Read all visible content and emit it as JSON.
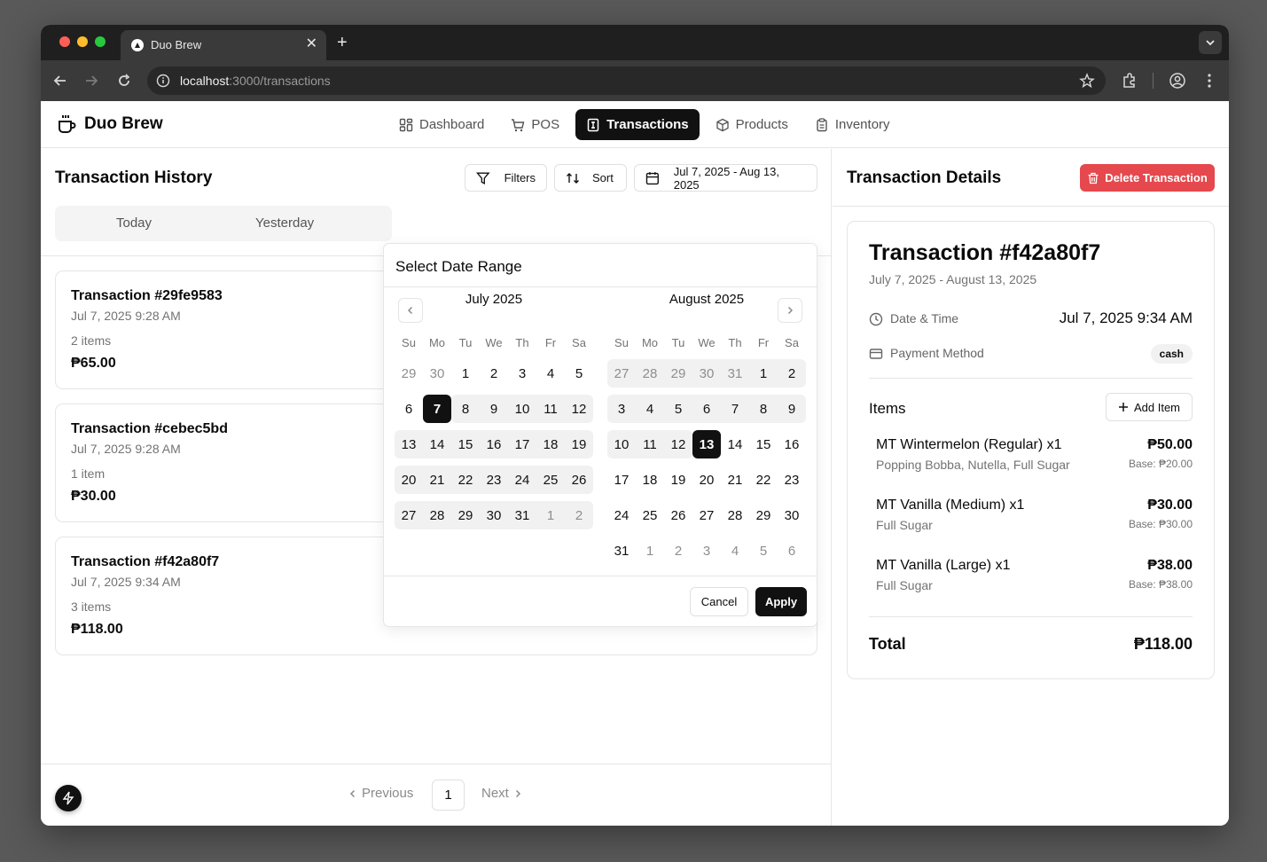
{
  "browser": {
    "tab_title": "Duo Brew",
    "url_host": "localhost",
    "url_path": ":3000/transactions"
  },
  "app": {
    "brand": "Duo Brew",
    "nav": [
      {
        "label": "Dashboard",
        "icon": "dashboard-icon"
      },
      {
        "label": "POS",
        "icon": "cart-icon"
      },
      {
        "label": "Transactions",
        "icon": "receipt-icon",
        "active": true
      },
      {
        "label": "Products",
        "icon": "package-icon"
      },
      {
        "label": "Inventory",
        "icon": "clipboard-icon"
      }
    ]
  },
  "history": {
    "title": "Transaction History",
    "filters_label": "Filters",
    "sort_label": "Sort",
    "date_range_label": "Jul 7, 2025 - Aug 13, 2025",
    "quick_tabs": [
      "Today",
      "Yesterday"
    ],
    "transactions": [
      {
        "title": "Transaction #29fe9583",
        "date": "Jul 7, 2025 9:28 AM",
        "items": "2 items",
        "total": "₱65.00"
      },
      {
        "title": "Transaction #cebec5bd",
        "date": "Jul 7, 2025 9:28 AM",
        "items": "1 item",
        "total": "₱30.00"
      },
      {
        "title": "Transaction #f42a80f7",
        "date": "Jul 7, 2025 9:34 AM",
        "items": "3 items",
        "total": "₱118.00"
      }
    ],
    "pagination": {
      "previous": "Previous",
      "page": "1",
      "next": "Next"
    }
  },
  "date_picker": {
    "title": "Select Date Range",
    "weekdays": [
      "Su",
      "Mo",
      "Tu",
      "We",
      "Th",
      "Fr",
      "Sa"
    ],
    "months": [
      {
        "title": "July 2025",
        "weeks": [
          [
            "29",
            "30",
            "1",
            "2",
            "3",
            "4",
            "5"
          ],
          [
            "6",
            "7",
            "8",
            "9",
            "10",
            "11",
            "12"
          ],
          [
            "13",
            "14",
            "15",
            "16",
            "17",
            "18",
            "19"
          ],
          [
            "20",
            "21",
            "22",
            "23",
            "24",
            "25",
            "26"
          ],
          [
            "27",
            "28",
            "29",
            "30",
            "31",
            "1",
            "2"
          ]
        ]
      },
      {
        "title": "August 2025",
        "weeks": [
          [
            "27",
            "28",
            "29",
            "30",
            "31",
            "1",
            "2"
          ],
          [
            "3",
            "4",
            "5",
            "6",
            "7",
            "8",
            "9"
          ],
          [
            "10",
            "11",
            "12",
            "13",
            "14",
            "15",
            "16"
          ],
          [
            "17",
            "18",
            "19",
            "20",
            "21",
            "22",
            "23"
          ],
          [
            "24",
            "25",
            "26",
            "27",
            "28",
            "29",
            "30"
          ],
          [
            "31",
            "1",
            "2",
            "3",
            "4",
            "5",
            "6"
          ]
        ]
      }
    ],
    "cancel_label": "Cancel",
    "apply_label": "Apply"
  },
  "details": {
    "title": "Transaction Details",
    "delete_label": "Delete Transaction",
    "transaction_title": "Transaction #f42a80f7",
    "range_subtitle": "July 7, 2025 - August 13, 2025",
    "date_time_label": "Date & Time",
    "date_time_value": "Jul 7, 2025 9:34 AM",
    "payment_label": "Payment Method",
    "payment_value": "cash",
    "items_label": "Items",
    "add_item_label": "Add Item",
    "items": [
      {
        "name": "MT Wintermelon (Regular) x1",
        "mods": "Popping Bobba, Nutella, Full Sugar",
        "price": "₱50.00",
        "base": "Base: ₱20.00"
      },
      {
        "name": "MT Vanilla (Medium) x1",
        "mods": "Full Sugar",
        "price": "₱30.00",
        "base": "Base: ₱30.00"
      },
      {
        "name": "MT Vanilla (Large) x1",
        "mods": "Full Sugar",
        "price": "₱38.00",
        "base": "Base: ₱38.00"
      }
    ],
    "total_label": "Total",
    "total_value": "₱118.00"
  },
  "colors": {
    "accent": "#111111",
    "danger": "#e5484d",
    "range_bg": "#f1f1f2"
  }
}
